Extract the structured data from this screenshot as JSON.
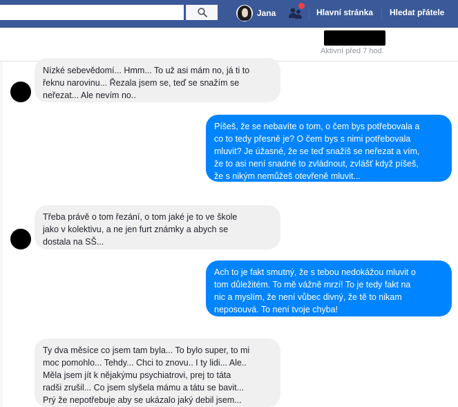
{
  "topbar": {
    "search_placeholder": "",
    "user_name": "Jana",
    "nav": [
      "Hlavní stránka",
      "Hledat přátele"
    ],
    "notification_color": "#fa3e3e",
    "bar_color": "#3b5998"
  },
  "chat": {
    "active_status": "Aktivní před 7 hod."
  },
  "messages": [
    {
      "from": "them",
      "text": "Nízké sebevědomí... Hmm... To už asi mám no, já ti to\nřeknu narovinu... Řezala jsem se, teď se snažím se\nneřezat... Ale nevím no.."
    },
    {
      "from": "me",
      "text": "Píšeš, že se nebavíte o tom, o čem bys potřebovala a\nco to tedy přesně je? O čem bys s nimi potřebovala\nmluvit? Je úžasné, že se teď snažíš se neřezat a vím,\nže to asi není snadné to zvládnout, zvlášť když píšeš,\nže s nikým nemůžeš otevřeně mluvit..."
    },
    {
      "from": "them",
      "text": "Třeba právě o tom řezání, o tom jaké je to ve škole\njako v kolektivu, a ne jen furt známky a abych se\ndostala na SŠ..."
    },
    {
      "from": "me",
      "text": "Ach to je fakt smutný, že s tebou nedokážou mluvit o\ntom důležitém. To mě vážně mrzí! To je tedy fakt na\nnic a myslím, že není vůbec divný, že tě to nikam\nneposouvá. To není tvoje chyba!"
    },
    {
      "from": "them",
      "text": "Ty dva měsíce co jsem tam byla... To bylo super, to mi\nmoc pomohlo... Tehdy... Chci to znovu.. I ty lidi... Ale..\nMěla jsem jít k nějakýmu psychiatrovi, prej to táta\nradši zrušil... Co jsem slyšela mámu a tátu se bavit...\nPrý že nepotřebuje aby se ukázalo jaký debil jsem..."
    }
  ]
}
